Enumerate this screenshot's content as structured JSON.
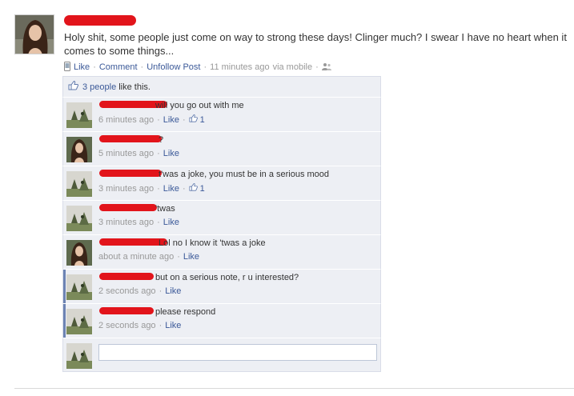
{
  "post": {
    "text": "Holy shit, some people just come on way to strong these days! Clinger much? I swear I have no heart when it comes to some things...",
    "actions": {
      "like": "Like",
      "comment": "Comment",
      "unfollow": "Unfollow Post",
      "time": "11 minutes ago",
      "via": "via mobile",
      "separator": "·"
    }
  },
  "likes": {
    "count_link": "3 people",
    "suffix": "like this."
  },
  "comments": [
    {
      "text": "will you go out with me",
      "time": "6 minutes ago",
      "like": "Like",
      "like_count": "1",
      "avatar": "guy"
    },
    {
      "text": "?",
      "time": "5 minutes ago",
      "like": "Like",
      "like_count": "",
      "avatar": "girl"
    },
    {
      "text": "t'was a joke, you must be in a serious mood",
      "time": "3 minutes ago",
      "like": "Like",
      "like_count": "1",
      "avatar": "guy"
    },
    {
      "text": "'twas",
      "time": "3 minutes ago",
      "like": "Like",
      "like_count": "",
      "avatar": "guy"
    },
    {
      "text": "Lol no I know it 'twas a joke",
      "time": "about a minute ago",
      "like": "Like",
      "like_count": "",
      "avatar": "girl"
    },
    {
      "text": "but on a serious note, r u interested?",
      "time": "2 seconds ago",
      "like": "Like",
      "like_count": "",
      "avatar": "guy"
    },
    {
      "text": "please respond",
      "time": "2 seconds ago",
      "like": "Like",
      "like_count": "",
      "avatar": "guy"
    }
  ],
  "compose": {
    "value": ""
  },
  "colors": {
    "link": "#3b5998",
    "redaction": "#e2141b",
    "feedback_bg": "#edeff4",
    "unread_bar": "#6d84b4"
  }
}
